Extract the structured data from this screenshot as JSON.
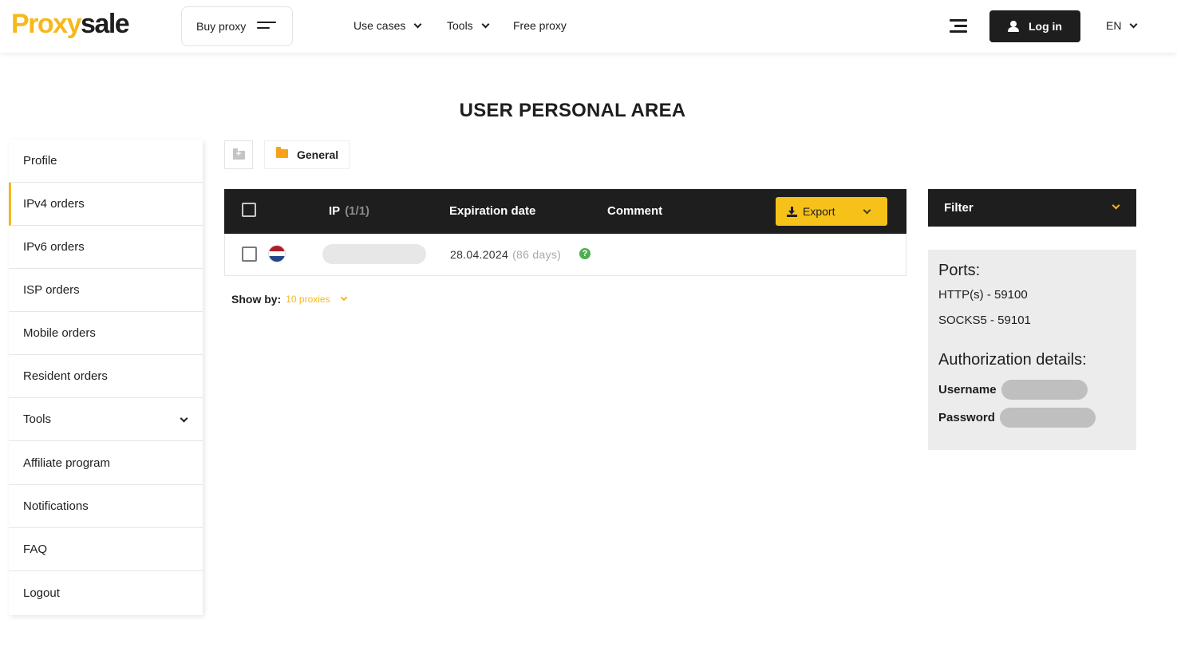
{
  "header": {
    "logo": {
      "part1": "Proxy",
      "part2": "sale"
    },
    "buy_proxy_label": "Buy proxy",
    "nav": [
      {
        "label": "Use cases",
        "has_dropdown": true
      },
      {
        "label": "Tools",
        "has_dropdown": true
      },
      {
        "label": "Free proxy",
        "has_dropdown": false
      }
    ],
    "login_label": "Log in",
    "language": "EN"
  },
  "page_title": "USER PERSONAL AREA",
  "sidebar": {
    "items": [
      {
        "label": "Profile"
      },
      {
        "label": "IPv4 orders",
        "active": true
      },
      {
        "label": "IPv6 orders"
      },
      {
        "label": "ISP orders"
      },
      {
        "label": "Mobile orders"
      },
      {
        "label": "Resident orders"
      },
      {
        "label": "Tools",
        "has_dropdown": true
      },
      {
        "label": "Affiliate program"
      },
      {
        "label": "Notifications"
      },
      {
        "label": "FAQ"
      },
      {
        "label": "Logout"
      }
    ]
  },
  "folders": {
    "items": [
      {
        "label": "General"
      }
    ]
  },
  "table": {
    "columns": {
      "ip": "IP",
      "ip_count": "(1/1)",
      "expiration": "Expiration date",
      "comment": "Comment"
    },
    "export_label": "Export",
    "rows": [
      {
        "country": "Netherlands",
        "ip": "",
        "date": "28.04.2024",
        "days": "(86 days)",
        "comment": ""
      }
    ]
  },
  "show_by": {
    "label": "Show by:",
    "value": "10 proxies"
  },
  "filter": {
    "label": "Filter"
  },
  "info": {
    "ports_title": "Ports:",
    "ports": [
      "HTTP(s) - 59100",
      "SOCKS5 - 59101"
    ],
    "auth_title": "Authorization details:",
    "username_label": "Username",
    "password_label": "Password"
  },
  "colors": {
    "accent": "#f6b81a",
    "dark": "#1e1e1e",
    "success": "#4caf50"
  }
}
